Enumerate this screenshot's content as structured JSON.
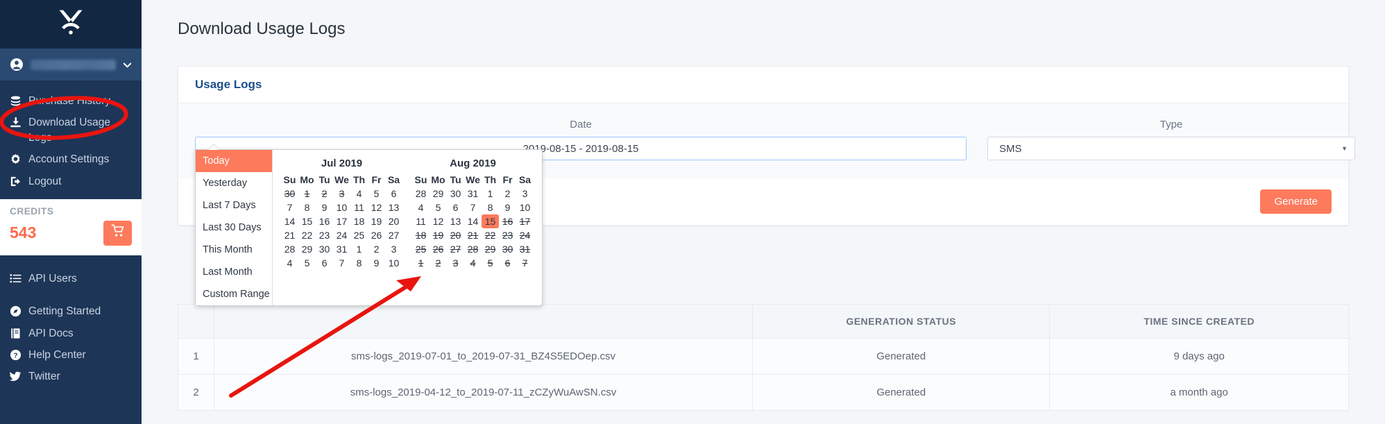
{
  "sidebar": {
    "logo_icon": "x-logo-icon",
    "user": {
      "icon": "user-circle-icon",
      "name_masked": "",
      "chevron": "chevron-down-icon"
    },
    "nav_primary": [
      {
        "icon": "coins-icon",
        "label": "Purchase History"
      },
      {
        "icon": "download-icon",
        "label": "Download Usage Logs"
      },
      {
        "icon": "gear-icon",
        "label": "Account Settings"
      },
      {
        "icon": "logout-icon",
        "label": "Logout"
      }
    ],
    "credits": {
      "label": "CREDITS",
      "value": "543",
      "cart_icon": "shopping-cart-icon"
    },
    "nav_secondary": [
      {
        "icon": "list-icon",
        "label": "API Users"
      }
    ],
    "nav_help": [
      {
        "icon": "compass-icon",
        "label": "Getting Started"
      },
      {
        "icon": "book-icon",
        "label": "API Docs"
      },
      {
        "icon": "question-icon",
        "label": "Help Center"
      },
      {
        "icon": "twitter-icon",
        "label": "Twitter"
      }
    ]
  },
  "page": {
    "title": "Download Usage Logs"
  },
  "card": {
    "header": "Usage Logs",
    "date_field": {
      "label": "Date",
      "value": "2019-08-15 - 2019-08-15"
    },
    "type_field": {
      "label": "Type",
      "value": "SMS",
      "caret_icon": "caret-down-icon"
    },
    "generate_button": "Generate"
  },
  "datepicker": {
    "ranges": [
      {
        "label": "Today",
        "active": true
      },
      {
        "label": "Yesterday",
        "active": false
      },
      {
        "label": "Last 7 Days",
        "active": false
      },
      {
        "label": "Last 30 Days",
        "active": false
      },
      {
        "label": "This Month",
        "active": false
      },
      {
        "label": "Last Month",
        "active": false
      },
      {
        "label": "Custom Range",
        "active": false
      }
    ],
    "weekdays": [
      "Su",
      "Mo",
      "Tu",
      "We",
      "Th",
      "Fr",
      "Sa"
    ],
    "left_calendar": {
      "title": "Jul 2019",
      "weeks": [
        [
          {
            "d": "30",
            "s": "off"
          },
          {
            "d": "1",
            "s": "off"
          },
          {
            "d": "2",
            "s": "off"
          },
          {
            "d": "3",
            "s": "off"
          },
          {
            "d": "4",
            "s": ""
          },
          {
            "d": "5",
            "s": ""
          },
          {
            "d": "6",
            "s": ""
          }
        ],
        [
          {
            "d": "7",
            "s": ""
          },
          {
            "d": "8",
            "s": ""
          },
          {
            "d": "9",
            "s": ""
          },
          {
            "d": "10",
            "s": ""
          },
          {
            "d": "11",
            "s": ""
          },
          {
            "d": "12",
            "s": ""
          },
          {
            "d": "13",
            "s": ""
          }
        ],
        [
          {
            "d": "14",
            "s": ""
          },
          {
            "d": "15",
            "s": ""
          },
          {
            "d": "16",
            "s": ""
          },
          {
            "d": "17",
            "s": ""
          },
          {
            "d": "18",
            "s": ""
          },
          {
            "d": "19",
            "s": ""
          },
          {
            "d": "20",
            "s": ""
          }
        ],
        [
          {
            "d": "21",
            "s": ""
          },
          {
            "d": "22",
            "s": ""
          },
          {
            "d": "23",
            "s": ""
          },
          {
            "d": "24",
            "s": ""
          },
          {
            "d": "25",
            "s": ""
          },
          {
            "d": "26",
            "s": ""
          },
          {
            "d": "27",
            "s": ""
          }
        ],
        [
          {
            "d": "28",
            "s": ""
          },
          {
            "d": "29",
            "s": ""
          },
          {
            "d": "30",
            "s": ""
          },
          {
            "d": "31",
            "s": ""
          },
          {
            "d": "1",
            "s": "dim"
          },
          {
            "d": "2",
            "s": "dim"
          },
          {
            "d": "3",
            "s": "dim"
          }
        ],
        [
          {
            "d": "4",
            "s": "dim"
          },
          {
            "d": "5",
            "s": "dim"
          },
          {
            "d": "6",
            "s": "dim"
          },
          {
            "d": "7",
            "s": "dim"
          },
          {
            "d": "8",
            "s": "dim"
          },
          {
            "d": "9",
            "s": "dim"
          },
          {
            "d": "10",
            "s": "dim"
          }
        ]
      ]
    },
    "right_calendar": {
      "title": "Aug 2019",
      "weeks": [
        [
          {
            "d": "28",
            "s": "dim"
          },
          {
            "d": "29",
            "s": "dim"
          },
          {
            "d": "30",
            "s": "dim"
          },
          {
            "d": "31",
            "s": "dim"
          },
          {
            "d": "1",
            "s": ""
          },
          {
            "d": "2",
            "s": ""
          },
          {
            "d": "3",
            "s": ""
          }
        ],
        [
          {
            "d": "4",
            "s": ""
          },
          {
            "d": "5",
            "s": ""
          },
          {
            "d": "6",
            "s": ""
          },
          {
            "d": "7",
            "s": ""
          },
          {
            "d": "8",
            "s": ""
          },
          {
            "d": "9",
            "s": ""
          },
          {
            "d": "10",
            "s": ""
          }
        ],
        [
          {
            "d": "11",
            "s": ""
          },
          {
            "d": "12",
            "s": ""
          },
          {
            "d": "13",
            "s": ""
          },
          {
            "d": "14",
            "s": ""
          },
          {
            "d": "15",
            "s": "sel"
          },
          {
            "d": "16",
            "s": "off"
          },
          {
            "d": "17",
            "s": "off"
          }
        ],
        [
          {
            "d": "18",
            "s": "off"
          },
          {
            "d": "19",
            "s": "off"
          },
          {
            "d": "20",
            "s": "off"
          },
          {
            "d": "21",
            "s": "off"
          },
          {
            "d": "22",
            "s": "off"
          },
          {
            "d": "23",
            "s": "off"
          },
          {
            "d": "24",
            "s": "off"
          }
        ],
        [
          {
            "d": "25",
            "s": "off"
          },
          {
            "d": "26",
            "s": "off"
          },
          {
            "d": "27",
            "s": "off"
          },
          {
            "d": "28",
            "s": "off"
          },
          {
            "d": "29",
            "s": "off"
          },
          {
            "d": "30",
            "s": "off"
          },
          {
            "d": "31",
            "s": "off"
          }
        ],
        [
          {
            "d": "1",
            "s": "off"
          },
          {
            "d": "2",
            "s": "off"
          },
          {
            "d": "3",
            "s": "off"
          },
          {
            "d": "4",
            "s": "off"
          },
          {
            "d": "5",
            "s": "off"
          },
          {
            "d": "6",
            "s": "off"
          },
          {
            "d": "7",
            "s": "off"
          }
        ]
      ]
    }
  },
  "table": {
    "columns": [
      "",
      "",
      "GENERATION STATUS",
      "TIME SINCE CREATED"
    ],
    "rows": [
      {
        "index": "1",
        "filename": "sms-logs_2019-07-01_to_2019-07-31_BZ4S5EDOep.csv",
        "status": "Generated",
        "time": "9 days ago"
      },
      {
        "index": "2",
        "filename": "sms-logs_2019-04-12_to_2019-07-11_zCZyWuAwSN.csv",
        "status": "Generated",
        "time": "a month ago"
      }
    ]
  },
  "annotations": {
    "ellipse_target": "Download Usage Logs",
    "arrow_target": "Jul 18 calendar cell",
    "color": "#e8150f"
  },
  "colors": {
    "sidebar_bg": "#1d3557",
    "accent": "#fd7a5c",
    "page_bg": "#f4f6f9",
    "link": "#fd7a5c",
    "card_header_text": "#1c4f8b"
  }
}
